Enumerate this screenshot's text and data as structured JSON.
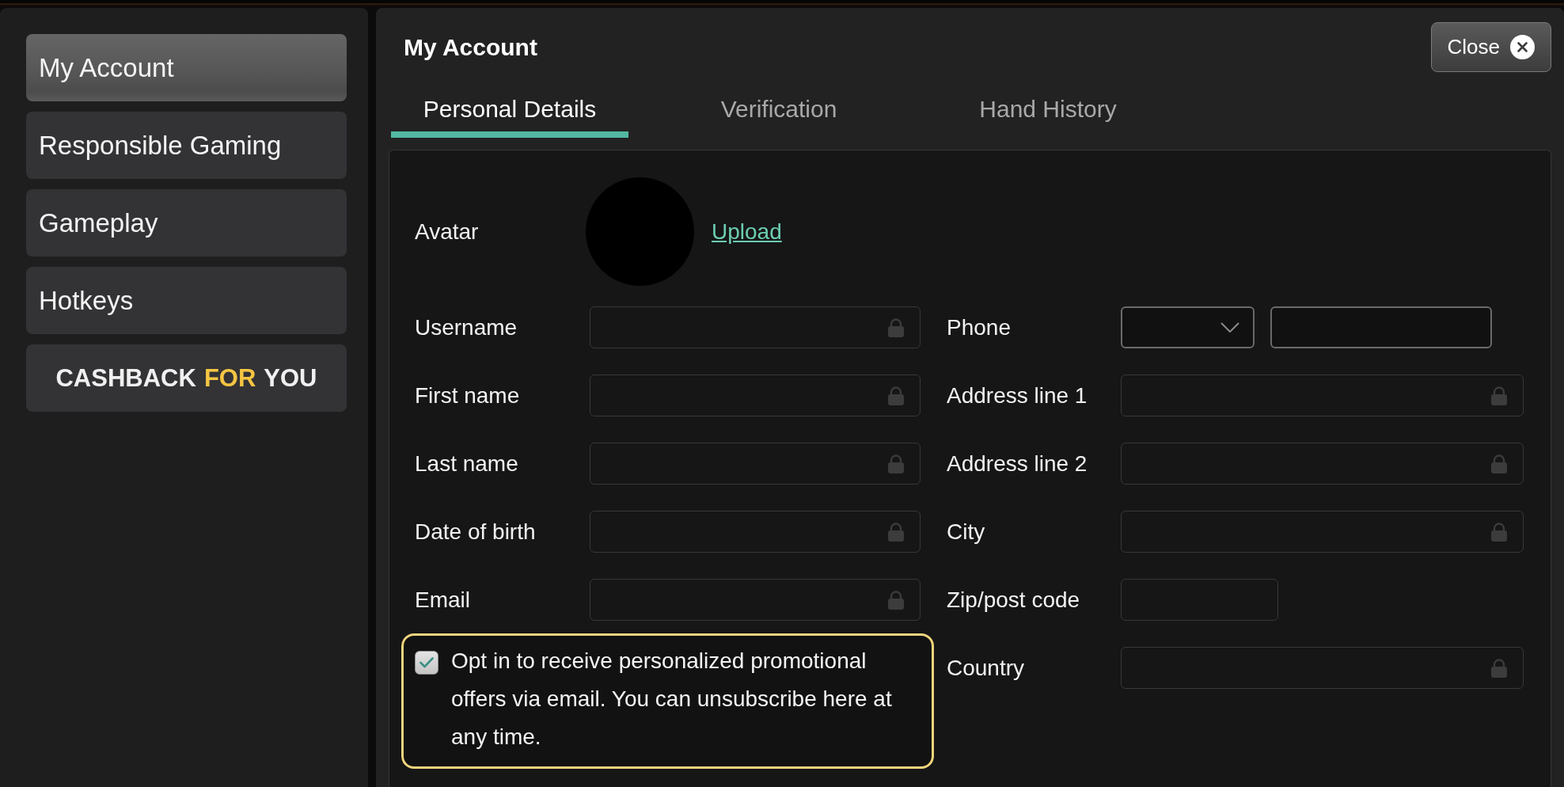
{
  "sidebar": {
    "items": [
      {
        "label": "My Account",
        "selected": true
      },
      {
        "label": "Responsible Gaming",
        "selected": false
      },
      {
        "label": "Gameplay",
        "selected": false
      },
      {
        "label": "Hotkeys",
        "selected": false
      }
    ],
    "promo": {
      "words": [
        {
          "text": "CASHBACK",
          "accent": false
        },
        {
          "text": "FOR",
          "accent": true
        },
        {
          "text": "YOU",
          "accent": false
        }
      ]
    }
  },
  "panel": {
    "title": "My Account",
    "close_button": "Close"
  },
  "tabs": [
    {
      "label": "Personal Details",
      "selected": true
    },
    {
      "label": "Verification",
      "selected": false
    },
    {
      "label": "Hand History",
      "selected": false
    }
  ],
  "form": {
    "avatar": {
      "label": "Avatar",
      "link": "Upload"
    },
    "left_fields": [
      {
        "label": "Username",
        "kind": "text",
        "locked": true
      },
      {
        "label": "First name",
        "kind": "text",
        "locked": true
      },
      {
        "label": "Last name",
        "kind": "text",
        "locked": true
      },
      {
        "label": "Date of birth",
        "kind": "text",
        "locked": true
      },
      {
        "label": "Email",
        "kind": "text",
        "locked": true
      }
    ],
    "opt_in": {
      "checked": true,
      "text": "Opt in to receive personalized promotional offers via email. You can unsubscribe here at any time."
    },
    "right_fields": [
      {
        "label": "Phone",
        "kind": "phone"
      },
      {
        "label": "Address line 1",
        "kind": "text",
        "locked": true
      },
      {
        "label": "Address line 2",
        "kind": "text",
        "locked": true
      },
      {
        "label": "City",
        "kind": "text",
        "locked": true
      },
      {
        "label": "Zip/post code",
        "kind": "short",
        "locked": false
      },
      {
        "label": "Country",
        "kind": "text",
        "locked": true
      }
    ]
  }
}
